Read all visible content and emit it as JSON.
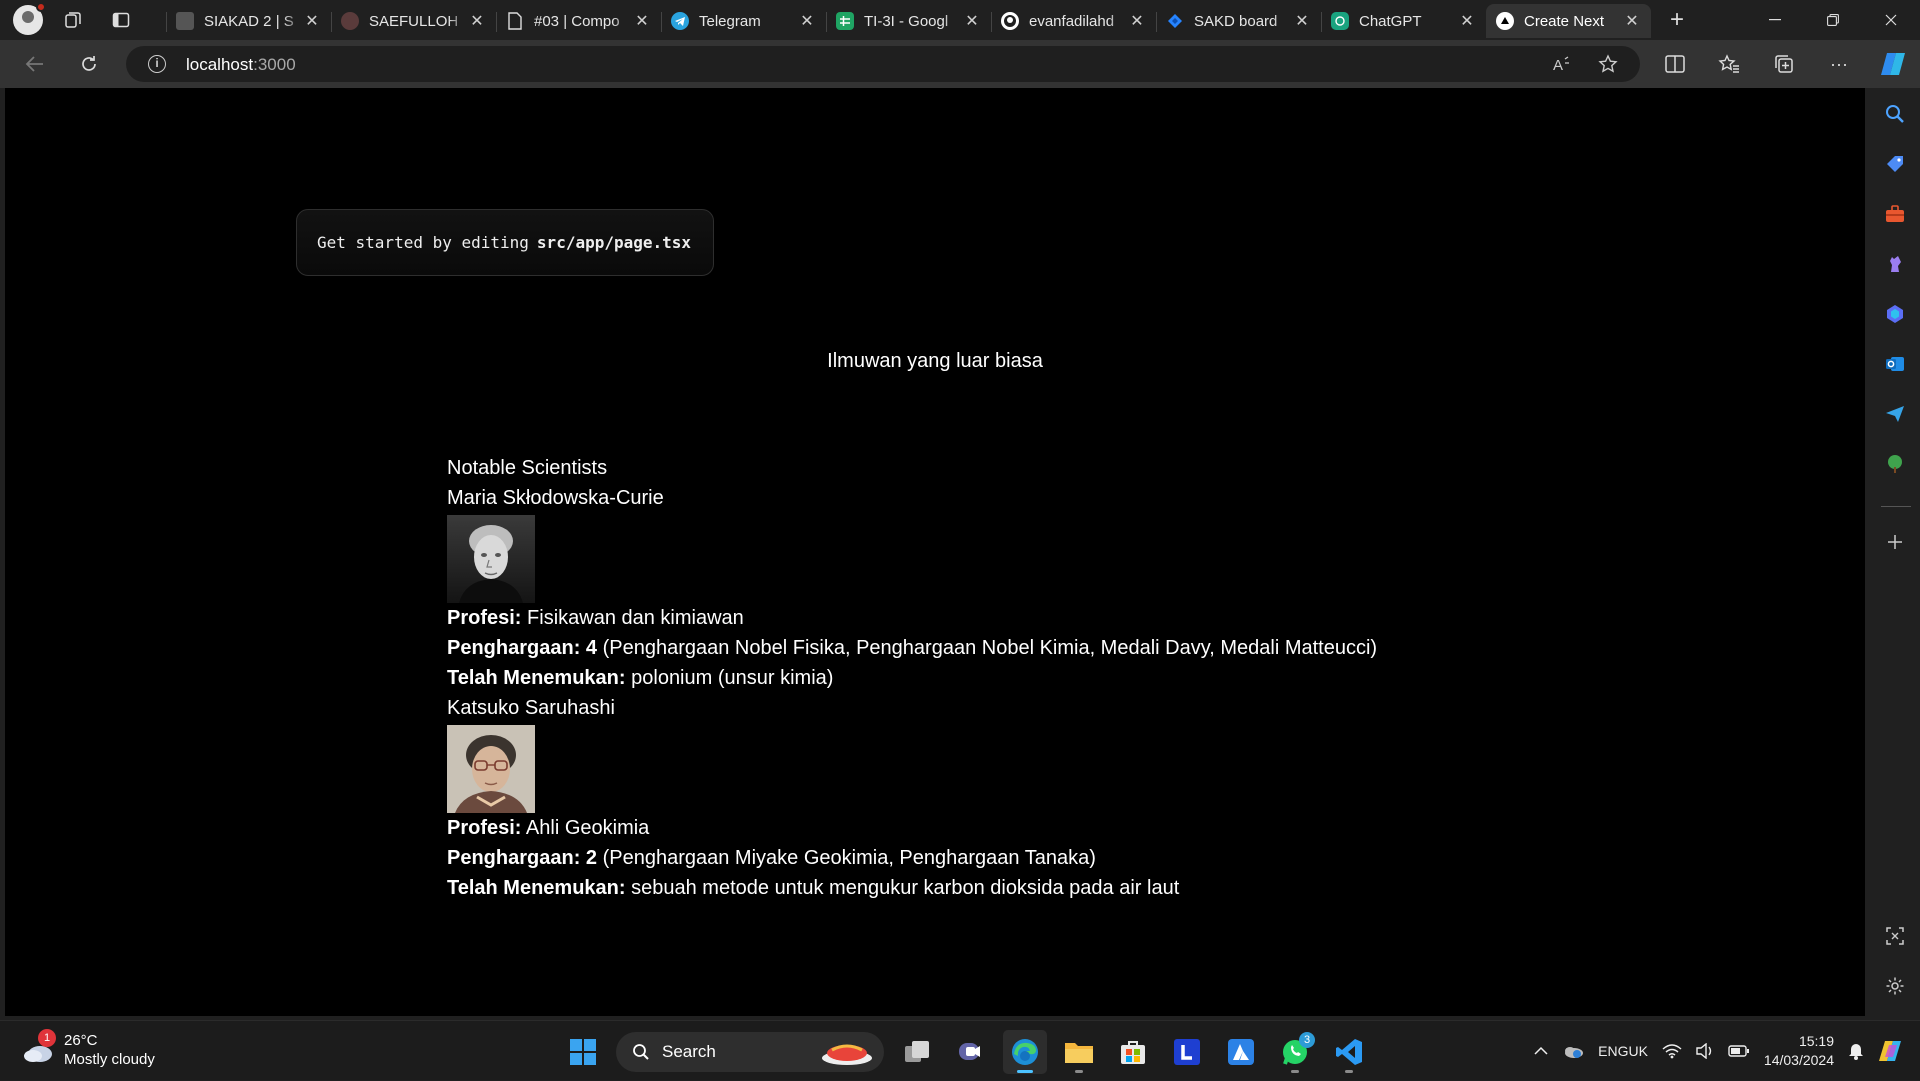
{
  "browser": {
    "tabs": [
      {
        "title": "SIAKAD 2 | S",
        "favicon": "siakad",
        "active": false
      },
      {
        "title": "SAEFULLOH",
        "favicon": "seal",
        "active": false
      },
      {
        "title": "#03 | Compo",
        "favicon": "document",
        "active": false
      },
      {
        "title": "Telegram",
        "favicon": "telegram",
        "active": false
      },
      {
        "title": "TI-3I - Googl",
        "favicon": "sheets",
        "active": false
      },
      {
        "title": "evanfadilahd",
        "favicon": "github",
        "active": false
      },
      {
        "title": "SAKD board",
        "favicon": "jira",
        "active": false
      },
      {
        "title": "ChatGPT",
        "favicon": "chatgpt",
        "active": false
      },
      {
        "title": "Create Next",
        "favicon": "nextjs",
        "active": true
      }
    ],
    "url_host": "localhost",
    "url_port": ":3000"
  },
  "page": {
    "code_prefix": "Get started by editing",
    "code_path": "src/app/page.tsx",
    "headline": "Ilmuwan yang luar biasa",
    "section_title": "Notable Scientists",
    "scientists": [
      {
        "name": "Maria Skłodowska-Curie",
        "profession_label": "Profesi:",
        "profession": "Fisikawan dan kimiawan",
        "awards_label": "Penghargaan: 4",
        "awards": "(Penghargaan Nobel Fisika, Penghargaan Nobel Kimia, Medali Davy, Medali Matteucci)",
        "discovery_label": "Telah Menemukan:",
        "discovery": "polonium (unsur kimia)"
      },
      {
        "name": "Katsuko Saruhashi",
        "profession_label": "Profesi:",
        "profession": "Ahli Geokimia",
        "awards_label": "Penghargaan: 2",
        "awards": "(Penghargaan Miyake Geokimia, Penghargaan Tanaka)",
        "discovery_label": "Telah Menemukan:",
        "discovery": "sebuah metode untuk mengukur karbon dioksida pada air laut"
      }
    ]
  },
  "taskbar": {
    "weather_temp": "26°C",
    "weather_desc": "Mostly cloudy",
    "weather_badge": "1",
    "search_label": "Search",
    "whatsapp_badge": "3",
    "lang_top": "ENG",
    "lang_bottom": "UK",
    "time": "15:19",
    "date": "14/03/2024"
  }
}
